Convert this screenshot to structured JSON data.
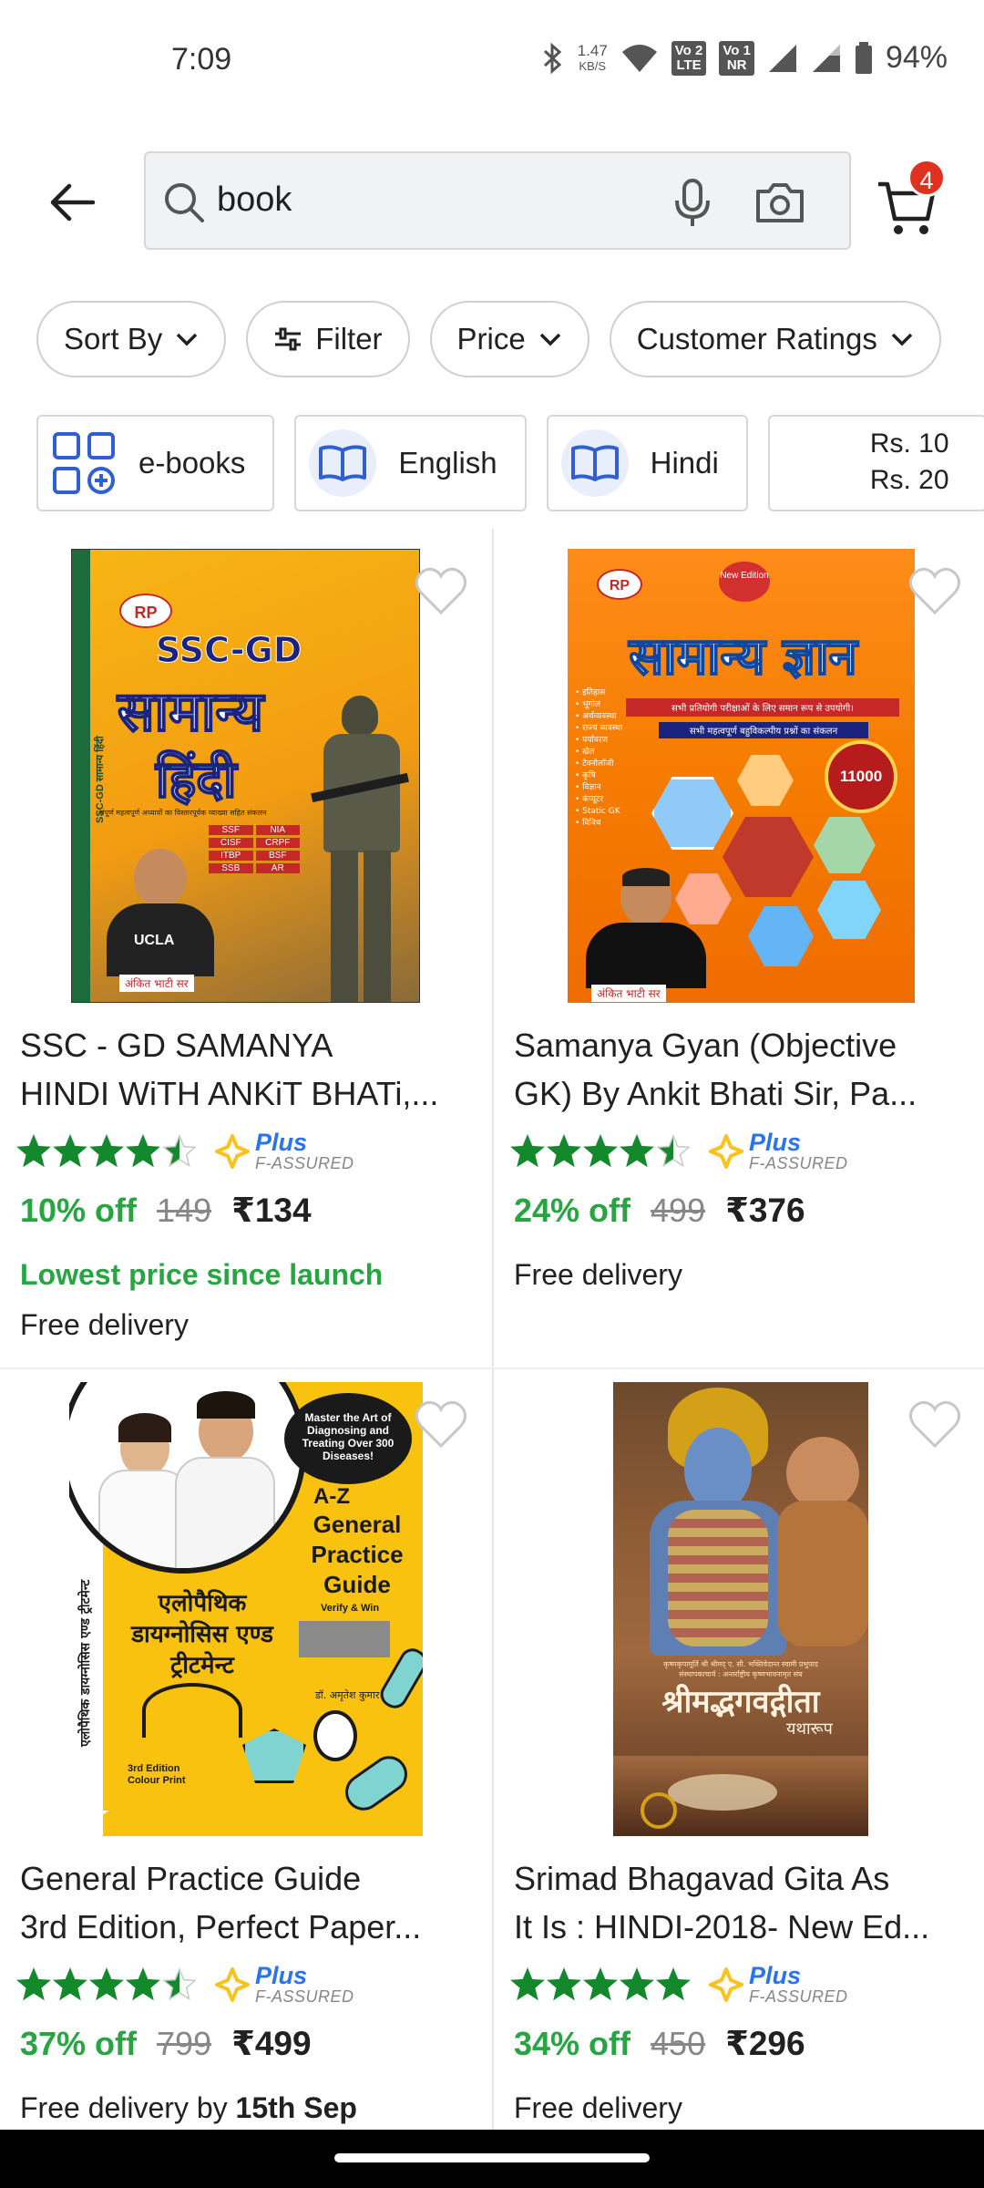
{
  "status_bar": {
    "time": "7:09",
    "net_speed": "1.47",
    "net_unit": "KB/S",
    "sim1_label_top": "Vo",
    "sim1_label_bottom": "LTE",
    "sim1_num": "2",
    "sim2_label_top": "Vo",
    "sim2_label_bottom": "NR",
    "sim2_num": "1",
    "battery": "94%"
  },
  "header": {
    "search_value": "book",
    "cart_count": "4"
  },
  "filters": {
    "sort_by": "Sort By",
    "filter": "Filter",
    "price": "Price",
    "customer_ratings": "Customer Ratings"
  },
  "categories": {
    "ebooks": "e-books",
    "english": "English",
    "hindi": "Hindi",
    "price_line1": "Rs. 10",
    "price_line2": "Rs. 20"
  },
  "products": [
    {
      "title_line1": "SSC - GD SAMANYA",
      "title_line2": "HINDI WiTH ANKiT BHATi,...",
      "rating": 4.5,
      "plus_label": "Plus",
      "assured_label": "F-ASSURED",
      "discount": "10% off",
      "mrp": "149",
      "price": "₹134",
      "highlight": "Lowest price since launch",
      "delivery": "Free delivery",
      "cover": {
        "logo": "RP",
        "title_top": "SSC-GD",
        "title_main": "सामान्य",
        "title_sub": "हिंदी",
        "spine": "SSC-GD सामान्य हिंदी",
        "tagline": "संपूर्ण महत्वपूर्ण अध्यायों का विस्तारपूर्वक व्याख्या सहित संकलन",
        "badges": [
          "SSF",
          "NIA",
          "CISF",
          "CRPF",
          "ITBP",
          "BSF",
          "SSB",
          "AR"
        ],
        "shirt": "UCLA",
        "author": "अंकित भाटी सर"
      }
    },
    {
      "title_line1": "Samanya Gyan (Objective",
      "title_line2": "GK) By Ankit Bhati Sir, Pa...",
      "rating": 4.5,
      "plus_label": "Plus",
      "assured_label": "F-ASSURED",
      "discount": "24% off",
      "mrp": "499",
      "price": "₹376",
      "delivery": "Free delivery",
      "cover": {
        "logo": "RP",
        "edition": "New Edition",
        "title": "सामान्य ज्ञान",
        "subtitle": "सभी प्रतियोगी परीक्षाओं के लिए समान रूप से उपयोगी।",
        "subtitle2": "सभी महत्वपूर्ण बहुविकल्पीय प्रश्नों का संकलन",
        "topics": [
          "इतिहास",
          "भूगोल",
          "अर्थव्यवस्था",
          "राज्य व्यवस्था",
          "पर्यावरण",
          "खेल",
          "टेक्नोलॉजी",
          "कृषि",
          "विज्ञान",
          "कंप्यूटर",
          "Static GK",
          "विविध"
        ],
        "seal": "11000",
        "author": "अंकित भाटी सर"
      }
    },
    {
      "title_line1": "General Practice Guide",
      "title_line2": "3rd Edition, Perfect Paper...",
      "rating": 4.5,
      "plus_label": "Plus",
      "assured_label": "F-ASSURED",
      "discount": "37% off",
      "mrp": "799",
      "price": "₹499",
      "delivery_prefix": "Free delivery by ",
      "delivery_date": "15th Sep",
      "cover": {
        "bubble": "Master the Art of Diagnosing and Treating Over 300 Diseases!",
        "az": "A-Z",
        "title_en1": "General",
        "title_en2": "Practice",
        "title_en3": "Guide",
        "verify": "Verify & Win",
        "title_hi1": "एलोपैथिक",
        "title_hi2": "डायग्नोसिस एण्ड",
        "title_hi3": "ट्रीटमेन्ट",
        "spine": "एलोपैथिक डायग्नोसिस एण्ड ट्रीटमेन्ट",
        "edition": "3rd Edition Colour Print",
        "author": "डॉ. अमृतेश कुमार"
      }
    },
    {
      "title_line1": "Srimad Bhagavad Gita As",
      "title_line2": "It Is : HINDI-2018- New Ed...",
      "rating": 5,
      "plus_label": "Plus",
      "assured_label": "F-ASSURED",
      "discount": "34% off",
      "mrp": "450",
      "price": "₹296",
      "delivery": "Free delivery",
      "cover": {
        "author_line": "कृष्णकृपामूर्ति श्री श्रीमद् ए. सी. भक्तिवेदान्त स्वामी प्रभुपाद",
        "author_line2": "संस्थापकाचार्य : अन्तर्राष्ट्रीय कृष्णभावनामृत संघ",
        "title": "श्रीमद्भगवद्गीता",
        "subtitle": "यथारूप"
      }
    }
  ],
  "colors": {
    "discount_green": "#26a541",
    "star_green": "#14892c",
    "plus_blue": "#2874f0",
    "badge_red": "#e0311f"
  }
}
